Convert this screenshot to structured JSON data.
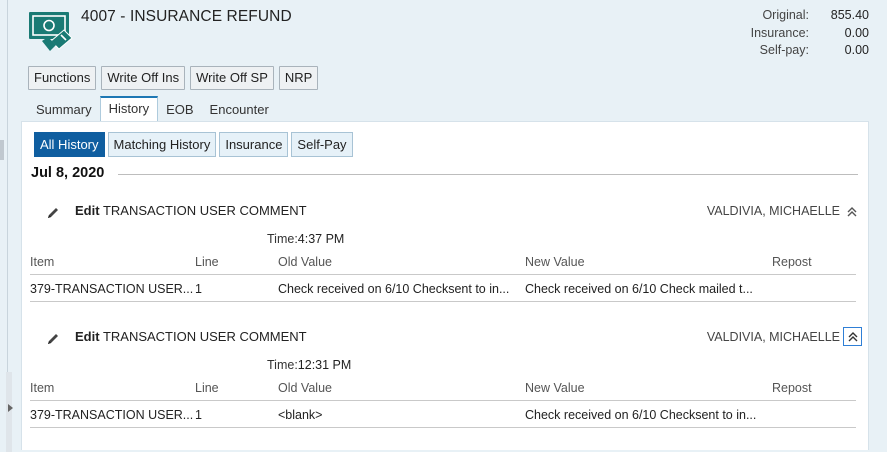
{
  "header": {
    "title": "4007 - INSURANCE REFUND",
    "icon": "cash-refund-icon",
    "brand_color": "#1a7a74"
  },
  "summary": {
    "original_label": "Original:",
    "original_value": "855.40",
    "insurance_label": "Insurance:",
    "insurance_value": "0.00",
    "selfpay_label": "Self-pay:",
    "selfpay_value": "0.00"
  },
  "toolbar": {
    "functions": "Functions",
    "write_off_ins": "Write Off Ins",
    "write_off_sp": "Write Off SP",
    "nrp": "NRP"
  },
  "tabs": [
    "Summary",
    "History",
    "EOB",
    "Encounter"
  ],
  "active_tab": "History",
  "filters": [
    "All History",
    "Matching History",
    "Insurance",
    "Self-Pay"
  ],
  "active_filter": "All History",
  "history": {
    "date": "Jul 8, 2020",
    "columns": [
      "Item",
      "Line",
      "Old Value",
      "New Value",
      "Repost"
    ],
    "entries": [
      {
        "action_verb": "Edit",
        "action_object": " TRANSACTION USER COMMENT",
        "user": "VALDIVIA, MICHAELLE",
        "time_label": "Time:",
        "time": "4:37 PM",
        "row": {
          "item": "379-TRANSACTION USER...",
          "line": "1",
          "old_value": "Check received on 6/10 Checksent to in...",
          "new_value": "Check received on 6/10 Check mailed t...",
          "repost": ""
        }
      },
      {
        "action_verb": "Edit",
        "action_object": " TRANSACTION USER COMMENT",
        "user": "VALDIVIA, MICHAELLE",
        "time_label": "Time:",
        "time": "12:31 PM",
        "row": {
          "item": "379-TRANSACTION USER...",
          "line": "1",
          "old_value": "<blank>",
          "new_value": "Check received on 6/10 Checksent to in...",
          "repost": ""
        }
      }
    ]
  }
}
